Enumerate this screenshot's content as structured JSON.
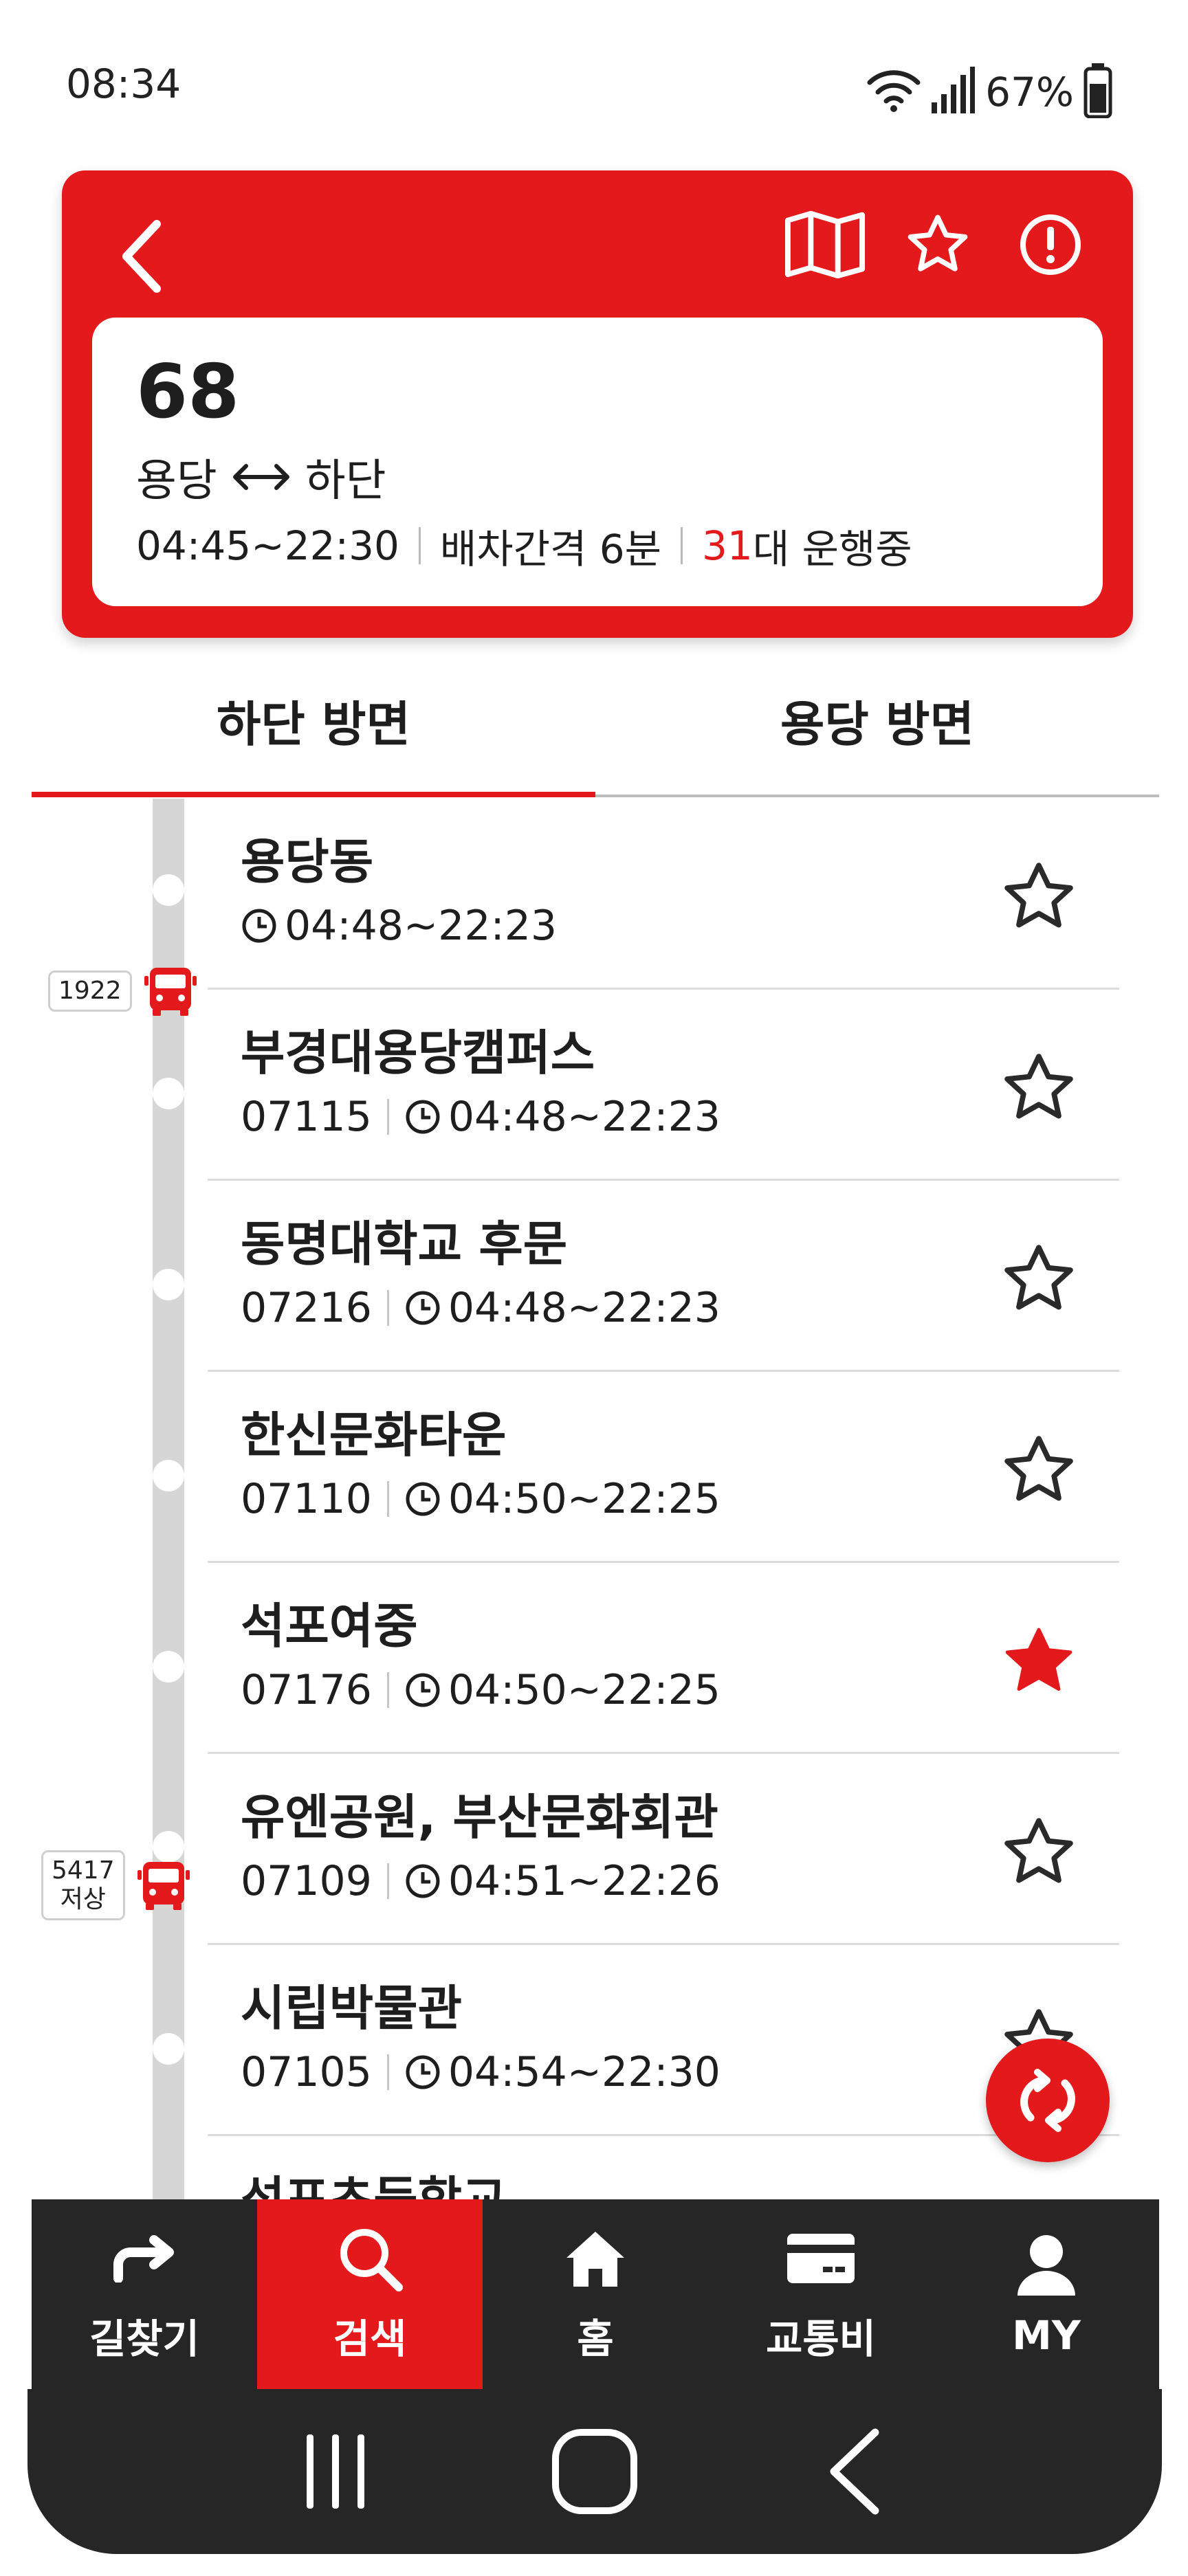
{
  "status_bar": {
    "time": "08:34",
    "battery": "67%"
  },
  "header": {
    "route_number": "68",
    "origin": "용당",
    "destination": "하단",
    "hours": "04:45~22:30",
    "interval": "배차간격 6분",
    "running_count": "31",
    "running_suffix": "대 운행중"
  },
  "tabs": [
    {
      "label": "하단 방면",
      "active": true
    },
    {
      "label": "용당 방면",
      "active": false
    }
  ],
  "stops": [
    {
      "name": "용당동",
      "code": "",
      "hours": "04:48~22:23",
      "favorite": false
    },
    {
      "name": "부경대용당캠퍼스",
      "code": "07115",
      "hours": "04:48~22:23",
      "favorite": false
    },
    {
      "name": "동명대학교 후문",
      "code": "07216",
      "hours": "04:48~22:23",
      "favorite": false
    },
    {
      "name": "한신문화타운",
      "code": "07110",
      "hours": "04:50~22:25",
      "favorite": false
    },
    {
      "name": "석포여중",
      "code": "07176",
      "hours": "04:50~22:25",
      "favorite": true
    },
    {
      "name": "유엔공원, 부산문화회관",
      "code": "07109",
      "hours": "04:51~22:26",
      "favorite": false
    },
    {
      "name": "시립박물관",
      "code": "07105",
      "hours": "04:54~22:30",
      "favorite": false
    },
    {
      "name": "석포초등학교",
      "code": "",
      "hours": "",
      "favorite": false
    }
  ],
  "buses": [
    {
      "label": "1922",
      "sub": ""
    },
    {
      "label": "5417",
      "sub": "저상"
    }
  ],
  "bottom_nav": [
    {
      "label": "길찾기",
      "icon": "route-arrow-icon",
      "active": false
    },
    {
      "label": "검색",
      "icon": "search-icon",
      "active": true
    },
    {
      "label": "홈",
      "icon": "home-icon",
      "active": false
    },
    {
      "label": "교통비",
      "icon": "card-icon",
      "active": false
    },
    {
      "label": "MY",
      "icon": "person-icon",
      "active": false
    }
  ],
  "colors": {
    "accent": "#e3191c",
    "nav_bg": "#262626"
  }
}
